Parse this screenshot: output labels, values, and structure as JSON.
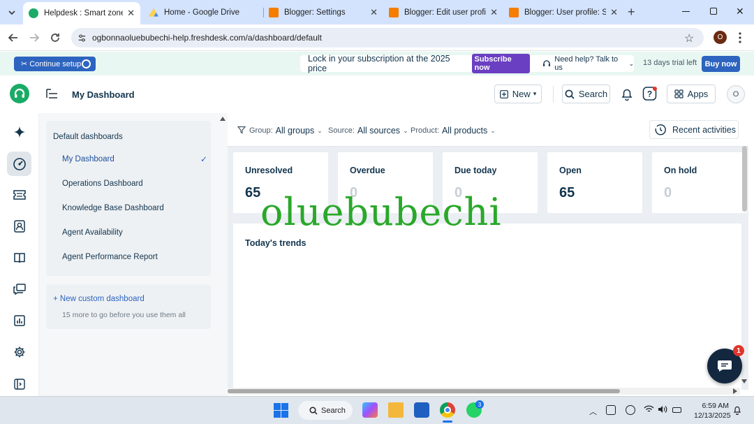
{
  "browser": {
    "tabs": [
      {
        "title": "Helpdesk : Smart zone pl",
        "active": true
      },
      {
        "title": "Home - Google Drive",
        "active": false
      },
      {
        "title": "Blogger: Settings",
        "active": false
      },
      {
        "title": "Blogger: Edit user profile",
        "active": false
      },
      {
        "title": "Blogger: User profile: Sm",
        "active": false
      }
    ],
    "url": "ogbonnaoluebubechi-help.freshdesk.com/a/dashboard/default",
    "profile_initial": "O"
  },
  "setup_bar": {
    "continue_label": "Continue setup",
    "promo_text": "Lock in your subscription at the 2025 price",
    "subscribe_label": "Subscribe now",
    "help_label": "Need help? Talk to us",
    "trial_text": "13 days trial left",
    "buy_label": "Buy now"
  },
  "header": {
    "title": "My Dashboard",
    "new_label": "New",
    "search_label": "Search",
    "apps_label": "Apps",
    "avatar_initial": "O"
  },
  "sidebar": {
    "section_title": "Default dashboards",
    "items": [
      {
        "label": "My Dashboard",
        "selected": true
      },
      {
        "label": "Operations Dashboard",
        "selected": false
      },
      {
        "label": "Knowledge Base Dashboard",
        "selected": false
      },
      {
        "label": "Agent Availability",
        "selected": false
      },
      {
        "label": "Agent Performance Report",
        "selected": false
      }
    ],
    "new_custom_label": "+ New custom dashboard",
    "custom_note": "15 more to go before you use them all"
  },
  "filters": {
    "group_label": "Group:",
    "group_value": "All groups",
    "source_label": "Source:",
    "source_value": "All sources",
    "product_label": "Product:",
    "product_value": "All products",
    "recent_label": "Recent activities"
  },
  "stats": [
    {
      "label": "Unresolved",
      "value": "65"
    },
    {
      "label": "Overdue",
      "value": "0"
    },
    {
      "label": "Due today",
      "value": "0"
    },
    {
      "label": "Open",
      "value": "65"
    },
    {
      "label": "On hold",
      "value": "0"
    }
  ],
  "trends_title": "Today's trends",
  "watermark": "oluebubechi",
  "chat_badge": "1",
  "taskbar": {
    "search_label": "Search",
    "whatsapp_badge": "3",
    "time": "6:59 AM",
    "date": "12/13/2025"
  },
  "colors": {
    "brand_green": "#1aab66",
    "primary_blue": "#2d64bf",
    "subscribe_purple": "#6b3fc2",
    "watermark_green": "#2aa82a"
  }
}
